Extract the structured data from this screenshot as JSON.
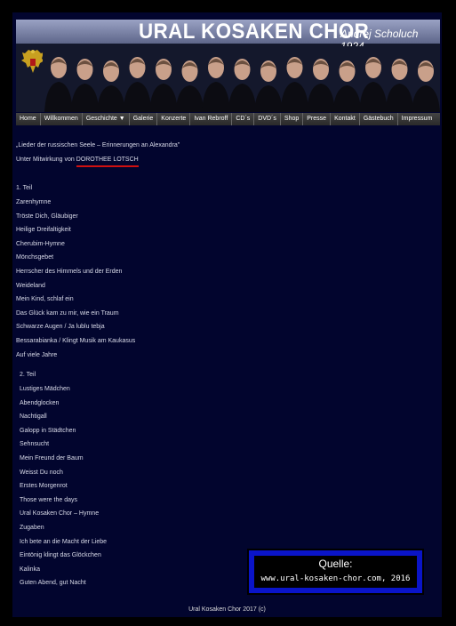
{
  "header": {
    "title": "URAL KOSAKEN CHOR",
    "subtitle": "Andrej Scholuch 1924"
  },
  "nav": [
    {
      "label": "Home"
    },
    {
      "label": "Willkommen"
    },
    {
      "label": "Geschichte ▼"
    },
    {
      "label": "Galerie"
    },
    {
      "label": "Konzerte"
    },
    {
      "label": "Ivan Rebroff"
    },
    {
      "label": "CD´s"
    },
    {
      "label": "DVD´s"
    },
    {
      "label": "Shop"
    },
    {
      "label": "Presse"
    },
    {
      "label": "Kontakt"
    },
    {
      "label": "Gästebuch"
    },
    {
      "label": "Impressum"
    }
  ],
  "content": {
    "intro": "„Lieder der russischen Seele – Erinnerungen an Alexandra\"",
    "with_prefix": "Unter Mitwirkung von",
    "with_name": "DOROTHEE LOTSCH",
    "part1_heading": "1. Teil",
    "part1": [
      "Zarenhymne",
      "Tröste Dich, Gläubiger",
      "Heilige Dreifaltigkeit",
      "Cherubim-Hymne",
      "Mönchsgebet",
      "Herrscher des Himmels und der Erden",
      "Weideland",
      "Mein Kind, schlaf ein",
      "Das Glück kam zu mir, wie ein Traum",
      "Schwarze Augen / Ja lublu tebja",
      "Bessarabianka / Klingt Musik am Kaukasus",
      "Auf viele Jahre"
    ],
    "part2_heading": "2. Teil",
    "part2": [
      "Lustiges Mädchen",
      "Abendglocken",
      "Nachtigall",
      "Galopp in Städtchen",
      "Sehnsucht",
      "Mein Freund der Baum",
      "Weisst Du noch",
      "Erstes Morgenrot",
      "Those were the days",
      "Ural Kosaken Chor – Hymne",
      "Zugaben",
      "Ich bete an die Macht der Liebe",
      "Eintönig klingt das Glöckchen",
      "Kalinka",
      "Guten Abend, gut Nacht"
    ]
  },
  "source": {
    "title": "Quelle:",
    "url": "www.ural-kosaken-chor.com, 2016"
  },
  "footer": "Ural Kosaken Chor 2017 (c)",
  "colors": {
    "background": "#000000",
    "page": "#02052e",
    "source_border": "#0a14c8",
    "highlight": "#d01010"
  }
}
